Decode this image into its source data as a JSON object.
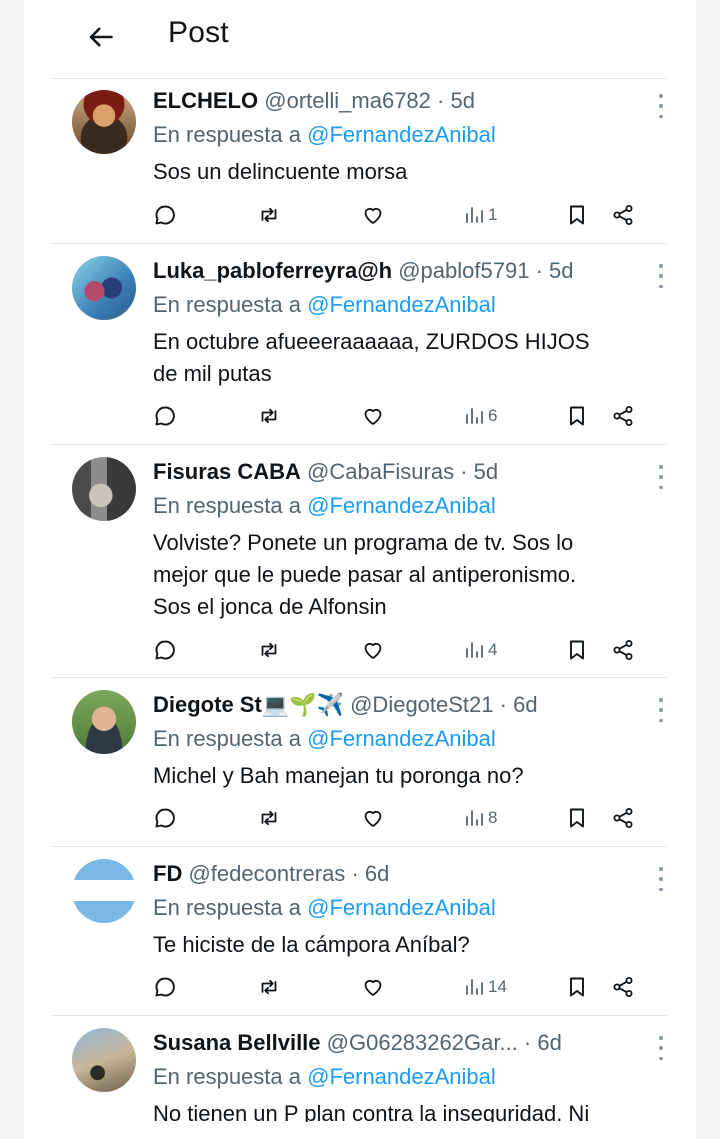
{
  "header": {
    "title": "Post"
  },
  "reply_prefix": "En respuesta a",
  "tweets": [
    {
      "name": "ELCHELO",
      "handle": "@ortelli_ma6782",
      "time": "· 5d",
      "mention": "@FernandezAnibal",
      "text_lines": [
        "Sos un delincuente morsa"
      ],
      "views": "1"
    },
    {
      "name": "Luka_pabloferreyra@h",
      "handle": "@pablof5791",
      "time": "· 5d",
      "mention": "@FernandezAnibal",
      "text_lines": [
        "En octubre afueeeraaaaaa, ZURDOS HIJOS",
        "de mil putas"
      ],
      "views": "6"
    },
    {
      "name": "Fisuras CABA",
      "handle": "@CabaFisuras",
      "time": "· 5d",
      "mention": "@FernandezAnibal",
      "text_lines": [
        "Volviste? Ponete un programa de tv. Sos lo",
        "mejor que le puede pasar al antiperonismo.",
        "Sos el jonca de Alfonsin"
      ],
      "views": "4"
    },
    {
      "name": "Diegote St💻🌱✈️",
      "handle": "@DiegoteSt21",
      "time": "· 6d",
      "mention": "@FernandezAnibal",
      "text_lines": [
        "Michel y Bah manejan tu poronga no?"
      ],
      "views": "8"
    },
    {
      "name": "FD",
      "handle": "@fedecontreras",
      "time": "· 6d",
      "mention": "@FernandezAnibal",
      "text_lines": [
        "Te hiciste de la cámpora Aníbal?"
      ],
      "views": "14"
    },
    {
      "name": "Susana Bellville",
      "handle": "@G06283262Gar...",
      "time": "· 6d",
      "mention": "@FernandezAnibal",
      "text_lines": [
        "No tienen un P plan contra la inseguridad. Ni"
      ],
      "views": ""
    }
  ],
  "icons": {
    "back": "arrow-left-icon",
    "more": "more-vertical-icon",
    "reply": "reply-icon",
    "retweet": "retweet-icon",
    "like": "heart-icon",
    "views": "views-icon",
    "bookmark": "bookmark-icon",
    "share": "share-icon"
  },
  "colors": {
    "text": "#0f1419",
    "secondary": "#536471",
    "accent": "#1d9bf0",
    "divider": "#e4e7ea",
    "background": "#f2f3f5"
  }
}
